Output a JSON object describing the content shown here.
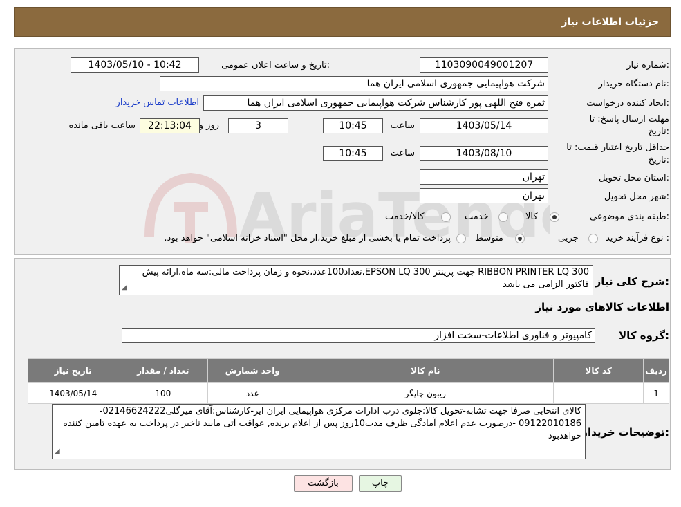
{
  "header": {
    "title": "جزئیات اطلاعات نیاز"
  },
  "form": {
    "need_number": {
      "label": "شماره نیاز:",
      "value": "1103090049001207"
    },
    "announce_datetime": {
      "label": "تاریخ و ساعت اعلان عمومی:",
      "value": "1403/05/10 - 10:42"
    },
    "buyer_org": {
      "label": "نام دستگاه خریدار:",
      "value": "شرکت هواپیمایی جمهوری اسلامی ایران هما"
    },
    "requester": {
      "label": "ایجاد کننده درخواست:",
      "value": "ثمره فتح اللهی پور کارشناس شرکت هواپیمایی جمهوری اسلامی ایران هما",
      "contact_link": "اطلاعات تماس خریدار"
    },
    "deadline": {
      "label_line1": "مهلت ارسال پاسخ: تا",
      "label_line2": "تاریخ:",
      "date": "1403/05/14",
      "time_label": "ساعت",
      "time": "10:45",
      "days": "3",
      "days_label": "روز و",
      "remaining": "22:13:04",
      "remaining_label": "ساعت باقی مانده"
    },
    "price_validity": {
      "label_line1": "حداقل تاریخ اعتبار قیمت: تا",
      "label_line2": "تاریخ:",
      "date": "1403/08/10",
      "time_label": "ساعت",
      "time": "10:45"
    },
    "province": {
      "label": "استان محل تحویل:",
      "value": "تهران"
    },
    "city": {
      "label": "شهر محل تحویل:",
      "value": "تهران"
    },
    "category": {
      "label": "طبقه بندی موضوعی:",
      "options": [
        "کالا",
        "خدمت",
        "کالا/خدمت"
      ],
      "selected": "کالا"
    },
    "process_type": {
      "label": "نوع فرآیند خرید :",
      "options": [
        "جزیی",
        "متوسط"
      ],
      "selected": "متوسط",
      "note": "پرداخت تمام یا بخشی از مبلغ خرید،از محل \"اسناد خزانه اسلامی\" خواهد بود."
    }
  },
  "summary": {
    "label": "شرح کلی نیاز:",
    "text": "RIBBON PRINTER LQ 300 جهت پرینتر EPSON LQ 300،تعداد100عدد،نحوه و زمان پرداخت مالی:سه ماه،ارائه پیش فاکتور الزامی می باشد"
  },
  "items_section": {
    "title": "اطلاعات کالاهای مورد نیاز",
    "group_label": "گروه کالا:",
    "group_value": "کامپیوتر و فناوری اطلاعات-سخت افزار",
    "columns": [
      "ردیف",
      "کد کالا",
      "نام کالا",
      "واحد شمارش",
      "تعداد / مقدار",
      "تاریخ نیاز"
    ],
    "rows": [
      [
        "1",
        "--",
        "ریبون چاپگر",
        "عدد",
        "100",
        "1403/05/14"
      ]
    ]
  },
  "buyer_notes": {
    "label": "توضیحات خریدار:",
    "text": "کالای انتخابی صرفا جهت تشابه-تحویل کالا:جلوی درب ادارات مرکزی هواپیمایی ایران ایر-کارشناس:آقای میرگلی02146624222-09122010186 -درصورت عدم اعلام آمادگی ظرف مدت10روز پس از اعلام برنده, عواقب آتی مانند تاخیر در پرداخت به عهده تامین کننده خواهدبود"
  },
  "buttons": {
    "print": "چاپ",
    "back": "بازگشت"
  },
  "colors": {
    "header_bg": "#8b6a3e",
    "table_header_bg": "#7a7a7a",
    "remaining_bg": "#fdfde0",
    "back_button_bg": "#fde3e3",
    "print_button_bg": "#e6f6e2",
    "link": "#1a3cc9"
  },
  "watermark": {
    "text": "AriaTender.neT"
  }
}
